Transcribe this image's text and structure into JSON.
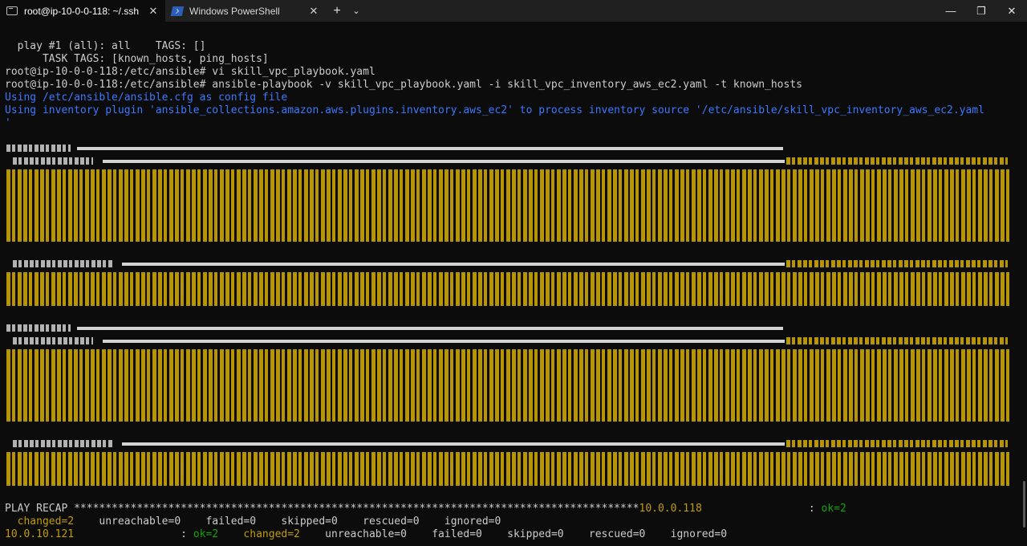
{
  "tabs": [
    {
      "title": "root@ip-10-0-0-118: ~/.ssh",
      "icon": "terminal-icon"
    },
    {
      "title": "Windows PowerShell",
      "icon": "powershell-icon"
    }
  ],
  "window_controls": {
    "new_tab": "+",
    "dropdown": "⌄",
    "minimize": "—",
    "maximize": "❐",
    "close": "✕"
  },
  "terminal": {
    "lines": [
      "  play #1 (all): all    TAGS: []",
      "      TASK TAGS: [known_hosts, ping_hosts]",
      "root@ip-10-0-0-118:/etc/ansible# vi skill_vpc_playbook.yaml",
      "root@ip-10-0-0-118:/etc/ansible# ansible-playbook -v skill_vpc_playbook.yaml -i skill_vpc_inventory_aws_ec2.yaml -t known_hosts",
      "Using /etc/ansible/ansible.cfg as config file",
      "Using inventory plugin 'ansible_collections.amazon.aws.plugins.inventory.aws_ec2' to process inventory source '/etc/ansible/skill_vpc_inventory_aws_ec2.yaml",
      "'"
    ],
    "recap": {
      "header": "PLAY RECAP ******************************************************************************************",
      "host1": "10.0.0.118",
      "host1_colon": "                 : ",
      "host1_ok": "ok=2",
      "host1_changed": "  changed=2",
      "host1_rest": "    unreachable=0    failed=0    skipped=0    rescued=0    ignored=0",
      "host2": "10.0.10.121",
      "host2_colon": "                 : ",
      "host2_ok": "ok=2",
      "host2_changed": "    changed=2",
      "host2_rest": "    unreachable=0    failed=0    skipped=0    rescued=0    ignored=0"
    }
  }
}
